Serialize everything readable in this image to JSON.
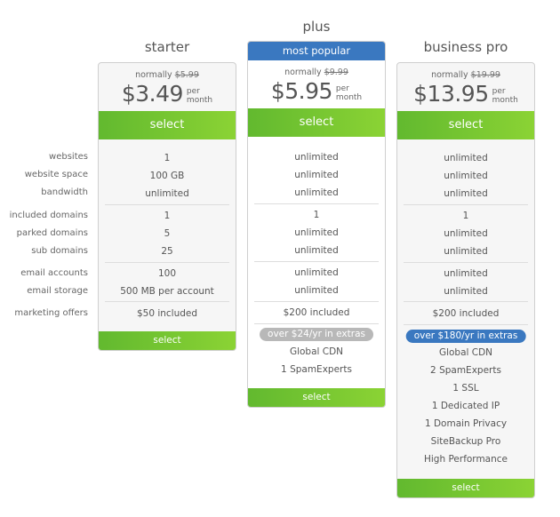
{
  "feature_labels": [
    "websites",
    "website space",
    "bandwidth",
    "included domains",
    "parked domains",
    "sub domains",
    "email accounts",
    "email storage",
    "marketing offers"
  ],
  "plans": [
    {
      "name": "starter",
      "normally_label": "normally",
      "old_price": "$5.99",
      "price": "$3.49",
      "per": "per",
      "period": "month",
      "select_label": "select",
      "features": [
        "1",
        "100 GB",
        "unlimited",
        "1",
        "5",
        "25",
        "100",
        "500 MB per account",
        "$50 included"
      ]
    },
    {
      "name": "plus",
      "badge": "most popular",
      "normally_label": "normally",
      "old_price": "$9.99",
      "price": "$5.95",
      "per": "per",
      "period": "month",
      "select_label": "select",
      "features": [
        "unlimited",
        "unlimited",
        "unlimited",
        "1",
        "unlimited",
        "unlimited",
        "unlimited",
        "unlimited",
        "$200 included"
      ],
      "extras_pill": "over $24/yr in extras",
      "extras": [
        "Global CDN",
        "1 SpamExperts"
      ]
    },
    {
      "name": "business pro",
      "normally_label": "normally",
      "old_price": "$19.99",
      "price": "$13.95",
      "per": "per",
      "period": "month",
      "select_label": "select",
      "features": [
        "unlimited",
        "unlimited",
        "unlimited",
        "1",
        "unlimited",
        "unlimited",
        "unlimited",
        "unlimited",
        "$200 included"
      ],
      "extras_pill": "over $180/yr in extras",
      "extras": [
        "Global CDN",
        "2 SpamExperts",
        "1 SSL",
        "1 Dedicated IP",
        "1 Domain Privacy",
        "SiteBackup Pro",
        "High Performance"
      ]
    }
  ],
  "colors": {
    "select_green_start": "#62b92f",
    "select_green_end": "#8bd334",
    "popular_blue": "#3a78c0",
    "pill_gray": "#b8b8b8"
  }
}
